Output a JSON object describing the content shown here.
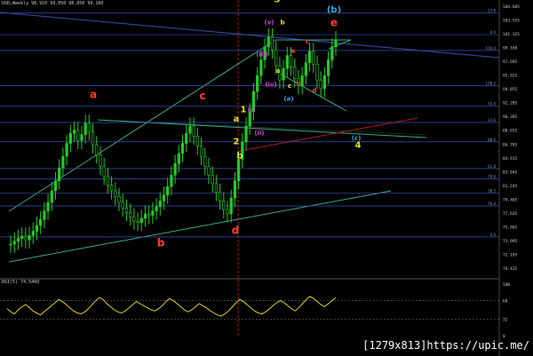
{
  "header": {
    "info": "USD,Weekly  98.910 99.050 98.850 99.160"
  },
  "indicator": {
    "label": "RSI(5) 74.5460",
    "levels": [
      "100",
      "68",
      "32",
      "0"
    ],
    "values": [
      52,
      46,
      42,
      50,
      56,
      60,
      55,
      48,
      44,
      40,
      46,
      52,
      58,
      64,
      70,
      66,
      60,
      54,
      48,
      44,
      42,
      46,
      52,
      60,
      68,
      74,
      70,
      62,
      56,
      50,
      46,
      44,
      48,
      54,
      60,
      66,
      62,
      58,
      54,
      50,
      48,
      52,
      58,
      66,
      72,
      68,
      62,
      56,
      50,
      46,
      50,
      56,
      62,
      58,
      54,
      48,
      44,
      40,
      38,
      42,
      48,
      56,
      64,
      70,
      66,
      60,
      54,
      48,
      44,
      42,
      46,
      52,
      58,
      64,
      68,
      64,
      58,
      52,
      48,
      54,
      62,
      70,
      76,
      72,
      66,
      60,
      56,
      62,
      68,
      74
    ]
  },
  "watermark": "[1279x813]https://upic.me/",
  "colors": {
    "background": "#000000",
    "candle": "#22cc22",
    "trendline": "#3aa88a",
    "fib_line": "#3a4fb0",
    "red_line": "#b01818",
    "rsi_line": "#e0d020",
    "label_red": "#ff4020",
    "label_yellow": "#e8e020",
    "label_cyan": "#30a0e0",
    "label_magenta": "#d040d0"
  },
  "chart_data": {
    "type": "candlestick",
    "title": "USD,Weekly",
    "price_axis": [
      "104.685",
      "103.555",
      "101.325",
      "99.160",
      "97.695",
      "95.925",
      "94.055",
      "92.285",
      "90.385",
      "88.655",
      "86.785",
      "84.915",
      "83.045",
      "81.245",
      "79.405",
      "77.635",
      "75.865",
      "73.995",
      "72.195",
      "70.425"
    ],
    "ylim": [
      68.5,
      105.5
    ],
    "price_series": [
      72.2,
      72.6,
      73.0,
      73.3,
      72.8,
      73.4,
      74.0,
      74.8,
      75.6,
      76.8,
      78.0,
      79.6,
      81.0,
      82.8,
      84.4,
      86.2,
      87.6,
      88.0,
      86.6,
      87.4,
      89.0,
      87.8,
      86.0,
      84.6,
      83.0,
      81.6,
      80.4,
      79.6,
      78.8,
      78.0,
      77.2,
      76.6,
      76.0,
      75.4,
      75.2,
      75.8,
      76.4,
      76.2,
      76.8,
      77.4,
      78.2,
      79.0,
      80.2,
      81.8,
      83.4,
      84.8,
      86.2,
      87.6,
      88.6,
      87.2,
      85.8,
      84.4,
      83.0,
      81.8,
      80.6,
      79.4,
      78.2,
      77.0,
      76.4,
      78.6,
      81.0,
      84.0,
      86.4,
      88.6,
      90.6,
      93.4,
      95.6,
      97.8,
      99.6,
      101.0,
      99.2,
      97.0,
      95.0,
      96.6,
      98.4,
      96.8,
      95.2,
      94.2,
      95.6,
      97.4,
      99.0,
      97.2,
      95.0,
      93.8,
      95.6,
      97.8,
      99.6,
      100.6
    ],
    "fib_levels": [
      {
        "label": "23.6",
        "price": 104.3
      },
      {
        "label": "0.0",
        "price": 101.3
      },
      {
        "label": "100.0",
        "price": 99.1
      },
      {
        "label": "138.2",
        "price": 94.2
      },
      {
        "label": "50.0",
        "price": 91.37
      },
      {
        "label": "23.6",
        "price": 89.1
      },
      {
        "label": "88.6",
        "price": 86.41
      },
      {
        "label": "61.8",
        "price": 82.7
      },
      {
        "label": "78.6",
        "price": 81.25
      },
      {
        "label": "38.2",
        "price": 79.3
      },
      {
        "label": "76.4",
        "price": 77.5
      },
      {
        "label": "0.0",
        "price": 73.2
      }
    ],
    "wave_labels": [
      {
        "text": "a",
        "color": "red",
        "price": 92.5
      },
      {
        "text": "b",
        "color": "red",
        "price": 71.9
      },
      {
        "text": "c",
        "color": "red",
        "price": 92.3
      },
      {
        "text": "d",
        "color": "red",
        "price": 73.6
      },
      {
        "text": "e",
        "color": "red",
        "price": 102.5
      },
      {
        "text": "3",
        "color": "yellow",
        "price": 105.8
      },
      {
        "text": "4",
        "color": "yellow",
        "price": 85.6
      },
      {
        "text": "1",
        "color": "yellow",
        "price": 90.5
      },
      {
        "text": "2",
        "color": "yellow",
        "price": 86.1
      },
      {
        "text": "a",
        "color": "yellow",
        "price": 89.2
      },
      {
        "text": "b",
        "color": "yellow",
        "price": 84.1
      },
      {
        "text": "(b)",
        "color": "cyan",
        "price": 104.4
      },
      {
        "text": "(c)",
        "color": "cyan",
        "price": 86.6
      },
      {
        "text": "(a)",
        "color": "cyan",
        "price": 92.1
      },
      {
        "text": "(v)",
        "color": "magenta",
        "price": 102.7
      },
      {
        "text": "b",
        "color": "yellow",
        "price": 102.7
      },
      {
        "text": "(iii)",
        "color": "magenta",
        "price": 98.3
      },
      {
        "text": "(iv)",
        "color": "magenta",
        "price": 94.1
      },
      {
        "text": "(i)",
        "color": "magenta",
        "price": 90.6
      },
      {
        "text": "(ii)",
        "color": "magenta",
        "price": 87.4
      },
      {
        "text": "a",
        "color": "yellow",
        "price": 96.0
      },
      {
        "text": "c",
        "color": "yellow",
        "price": 93.9
      },
      {
        "text": "a",
        "color": "red",
        "price": 98.8
      },
      {
        "text": "c",
        "color": "red",
        "price": 100.1
      },
      {
        "text": "b",
        "color": "red",
        "price": 94.2
      },
      {
        "text": "d",
        "color": "red",
        "price": 93.3
      }
    ],
    "grid": false
  }
}
